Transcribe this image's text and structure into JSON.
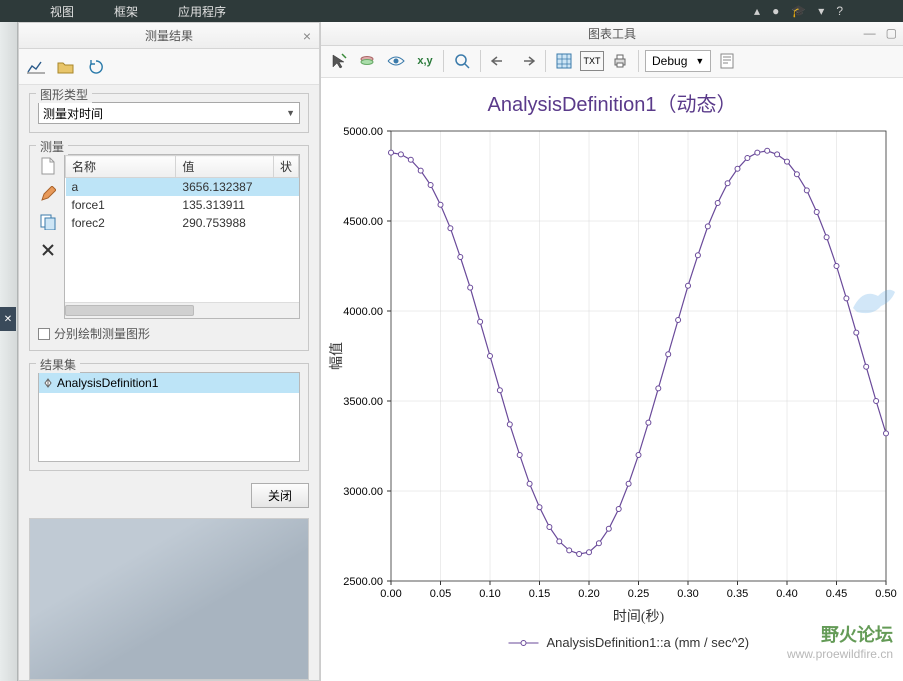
{
  "menubar": {
    "items": [
      "视图",
      "框架",
      "应用程序"
    ]
  },
  "left_panel": {
    "title": "测量结果",
    "group_graph_type": {
      "legend": "图形类型",
      "selected": "测量对时间"
    },
    "group_measure": {
      "legend": "测量",
      "columns": [
        "名称",
        "值",
        "状"
      ],
      "rows": [
        {
          "name": "a",
          "value": "3656.132387"
        },
        {
          "name": "force1",
          "value": "135.313911"
        },
        {
          "name": "forec2",
          "value": "290.753988"
        }
      ],
      "checkbox_label": "分别绘制测量图形"
    },
    "group_result": {
      "legend": "结果集",
      "items": [
        "AnalysisDefinition1"
      ]
    },
    "close_btn": "关闭"
  },
  "right_panel": {
    "title": "图表工具",
    "debug_label": "Debug",
    "chart_title": "AnalysisDefinition1（动态）",
    "xlabel": "时间(秒)",
    "ylabel": "幅值",
    "legend_text": "AnalysisDefinition1::a  (mm / sec^2)"
  },
  "watermark": {
    "line1": "野火论坛",
    "line2": "www.proewildfire.cn"
  },
  "chart_data": {
    "type": "line",
    "title": "AnalysisDefinition1（动态）",
    "xlabel": "时间(秒)",
    "ylabel": "幅值",
    "xlim": [
      0.0,
      0.5
    ],
    "ylim": [
      2500,
      5000
    ],
    "xticks": [
      0.0,
      0.05,
      0.1,
      0.15,
      0.2,
      0.25,
      0.3,
      0.35,
      0.4,
      0.45,
      0.5
    ],
    "yticks": [
      2500,
      3000,
      3500,
      4000,
      4500,
      5000
    ],
    "series": [
      {
        "name": "AnalysisDefinition1::a (mm / sec^2)",
        "x": [
          0.0,
          0.01,
          0.02,
          0.03,
          0.04,
          0.05,
          0.06,
          0.07,
          0.08,
          0.09,
          0.1,
          0.11,
          0.12,
          0.13,
          0.14,
          0.15,
          0.16,
          0.17,
          0.18,
          0.19,
          0.2,
          0.21,
          0.22,
          0.23,
          0.24,
          0.25,
          0.26,
          0.27,
          0.28,
          0.29,
          0.3,
          0.31,
          0.32,
          0.33,
          0.34,
          0.35,
          0.36,
          0.37,
          0.38,
          0.39,
          0.4,
          0.41,
          0.42,
          0.43,
          0.44,
          0.45,
          0.46,
          0.47,
          0.48,
          0.49,
          0.5
        ],
        "y": [
          4880,
          4870,
          4840,
          4780,
          4700,
          4590,
          4460,
          4300,
          4130,
          3940,
          3750,
          3560,
          3370,
          3200,
          3040,
          2910,
          2800,
          2720,
          2670,
          2650,
          2660,
          2710,
          2790,
          2900,
          3040,
          3200,
          3380,
          3570,
          3760,
          3950,
          4140,
          4310,
          4470,
          4600,
          4710,
          4790,
          4850,
          4880,
          4890,
          4870,
          4830,
          4760,
          4670,
          4550,
          4410,
          4250,
          4070,
          3880,
          3690,
          3500,
          3320
        ]
      }
    ]
  }
}
